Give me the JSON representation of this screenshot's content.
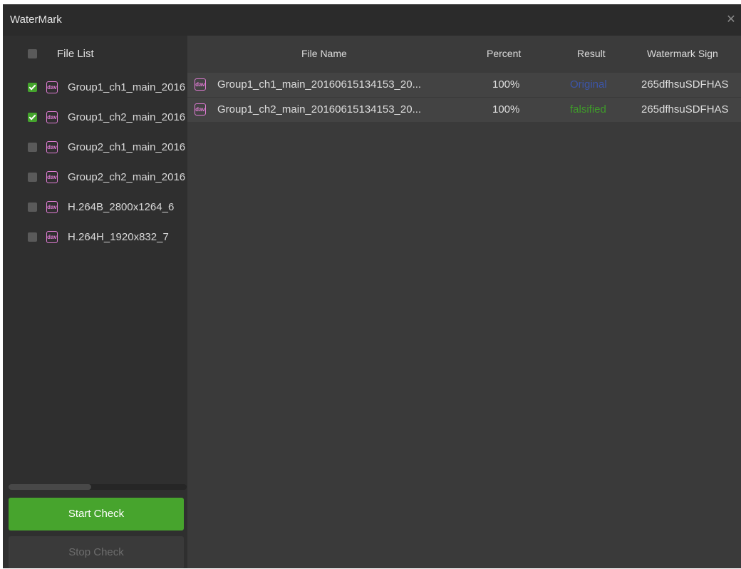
{
  "window": {
    "title": "WaterMark",
    "close_icon": "close-icon"
  },
  "left_panel": {
    "header_label": "File List",
    "files": [
      {
        "name": "Group1_ch1_main_2016",
        "checked": true
      },
      {
        "name": "Group1_ch2_main_2016",
        "checked": true
      },
      {
        "name": "Group2_ch1_main_2016",
        "checked": false
      },
      {
        "name": "Group2_ch2_main_2016",
        "checked": false
      },
      {
        "name": "H.264B_2800x1264_6",
        "checked": false
      },
      {
        "name": "H.264H_1920x832_7",
        "checked": false
      }
    ],
    "file_icon": "dav-file-icon",
    "file_icon_text": "dav",
    "start_label": "Start Check",
    "stop_label": "Stop Check"
  },
  "table": {
    "columns": [
      "File Name",
      "Percent",
      "Result",
      "Watermark Sign"
    ],
    "rows": [
      {
        "file": "Group1_ch1_main_20160615134153_20...",
        "percent": "100%",
        "result": "Original",
        "sign": "265dfhsuSDFHAS"
      },
      {
        "file": "Group1_ch2_main_20160615134153_20...",
        "percent": "100%",
        "result": "falsified",
        "sign": "265dfhsuSDFHAS"
      }
    ]
  },
  "colors": {
    "accent_green": "#47a42d",
    "original": "#3c55a8",
    "falsified": "#3f9b2a",
    "file_icon": "#e07cd4"
  }
}
